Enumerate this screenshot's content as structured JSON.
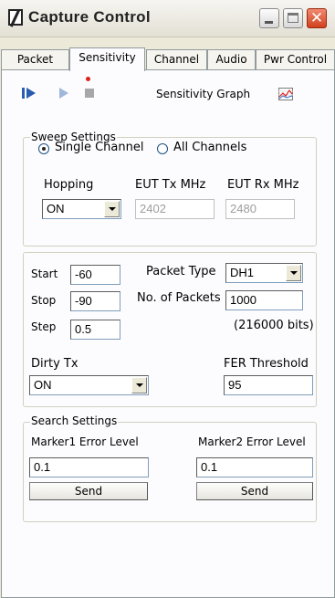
{
  "window": {
    "title": "Capture Control"
  },
  "tabs": [
    {
      "label": "Packet",
      "active": false
    },
    {
      "label": "Sensitivity",
      "active": true
    },
    {
      "label": "Channel",
      "active": false
    },
    {
      "label": "Audio",
      "active": false
    },
    {
      "label": "Pwr Control",
      "active": false
    }
  ],
  "toolbar": {
    "graph_label": "Sensitivity Graph",
    "icons": [
      "step-play-icon",
      "play-icon",
      "stop-icon",
      "graph-icon"
    ],
    "indicator_color": "#dd2222"
  },
  "sweep": {
    "legend": "Sweep Settings",
    "options": [
      "Single Channel",
      "All Channels"
    ],
    "selected": "Single Channel",
    "hopping_label": "Hopping",
    "hopping_value": "ON",
    "eut_tx_label": "EUT Tx MHz",
    "eut_tx_value": "2402",
    "eut_rx_label": "EUT Rx MHz",
    "eut_rx_value": "2480"
  },
  "params": {
    "start_label": "Start",
    "start_value": "-60",
    "stop_label": "Stop",
    "stop_value": "-90",
    "step_label": "Step",
    "step_value": "0.5",
    "packet_type_label": "Packet Type",
    "packet_type_value": "DH1",
    "packets_label": "No. of Packets",
    "packets_value": "1000",
    "bits_text": "(216000 bits)",
    "dirty_tx_label": "Dirty Tx",
    "dirty_tx_value": "ON",
    "fer_label": "FER Threshold",
    "fer_value": "95"
  },
  "search": {
    "legend": "Search Settings",
    "marker1_label": "Marker1 Error Level",
    "marker1_value": "0.1",
    "marker2_label": "Marker2 Error Level",
    "marker2_value": "0.1",
    "send_label": "Send"
  }
}
